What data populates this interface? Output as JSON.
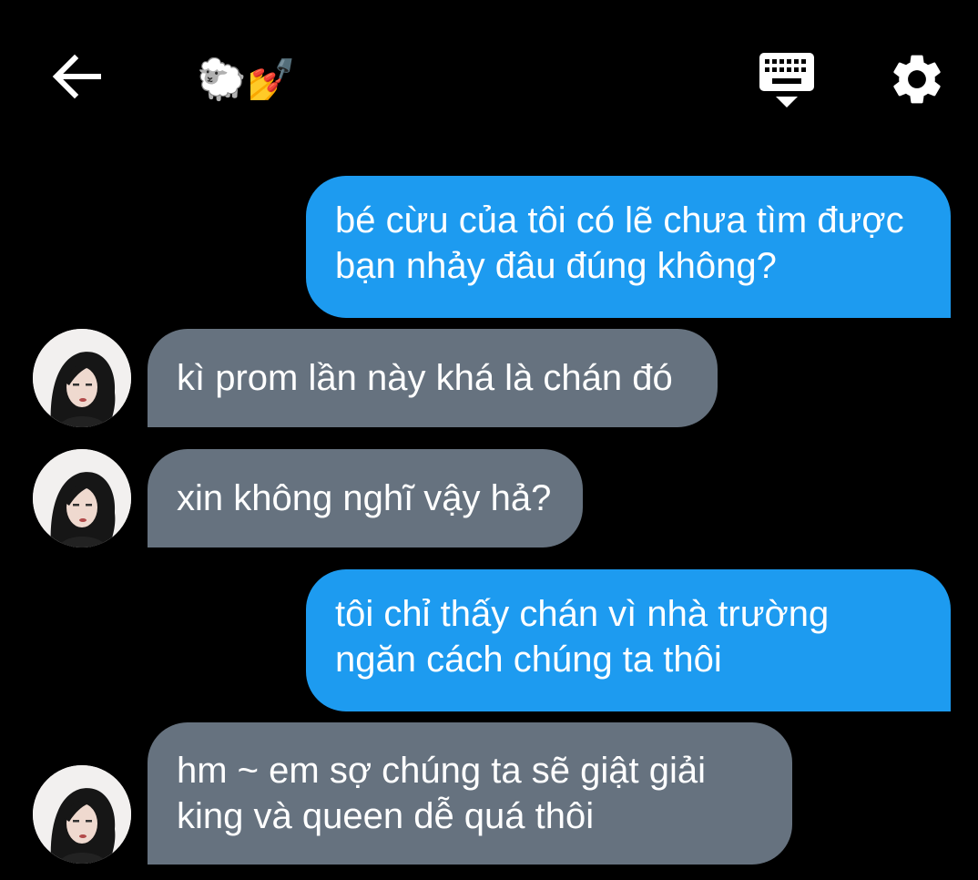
{
  "header": {
    "title": "🐑💅",
    "back_icon": "arrow-left-icon",
    "keyboard_icon": "keyboard-icon",
    "settings_icon": "gear-icon"
  },
  "colors": {
    "background": "#000000",
    "sent_bubble": "#1d9bf0",
    "received_bubble": "#66727f",
    "text": "#ffffff"
  },
  "messages": [
    {
      "from": "me",
      "text": "bé cừu của tôi có lẽ chưa tìm được\nbạn nhảy đâu đúng không?"
    },
    {
      "from": "them",
      "text": "kì prom lần này khá là chán đó"
    },
    {
      "from": "them",
      "text": "xin không nghĩ vậy hả?"
    },
    {
      "from": "me",
      "text": "tôi chỉ thấy chán vì nhà trường\nngăn cách chúng ta thôi"
    },
    {
      "from": "them",
      "text": "hm ~ em sợ chúng ta sẽ giật giải\nking và queen dễ quá thôi"
    }
  ]
}
